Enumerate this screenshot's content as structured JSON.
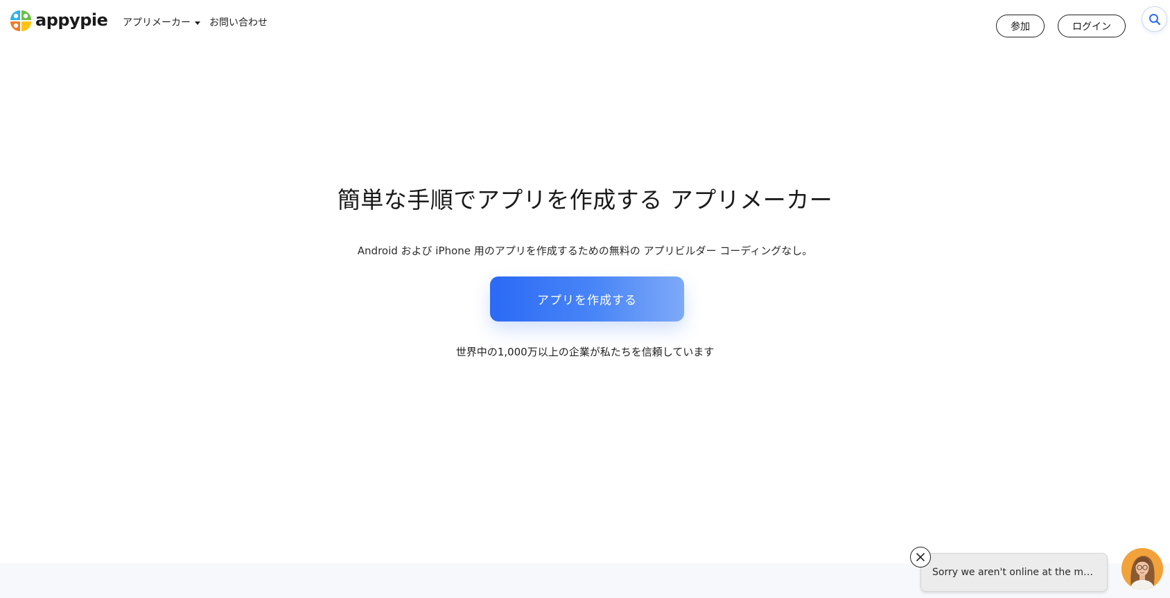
{
  "brand": {
    "name": "appypie",
    "logo_colors": [
      "#2bb3e6",
      "#f47b20",
      "#ffc20e",
      "#6cbd45"
    ]
  },
  "nav": {
    "items": [
      {
        "label": "アプリメーカー",
        "has_dropdown": true
      },
      {
        "label": "お問い合わせ",
        "has_dropdown": false
      }
    ]
  },
  "header": {
    "join_label": "参加",
    "login_label": "ログイン",
    "search_icon": "search-icon"
  },
  "hero": {
    "title": "簡単な手順でアプリを作成する アプリメーカー",
    "subtitle": "Android および iPhone 用のアプリを作成するための無料の アプリビルダー コーディングなし。",
    "cta_label": "アプリを作成する",
    "trust_text": "世界中の1,000万以上の企業が私たちを信頼しています"
  },
  "chat": {
    "message": "Sorry we aren't online at the moment. Leave a message and we'll get back to you.",
    "close_icon": "close-icon",
    "avatar_icon": "agent-avatar-icon"
  },
  "colors": {
    "accent": "#2a6af5",
    "accent_light": "#7ea9f7",
    "avatar_bg": "#f2a23a"
  }
}
